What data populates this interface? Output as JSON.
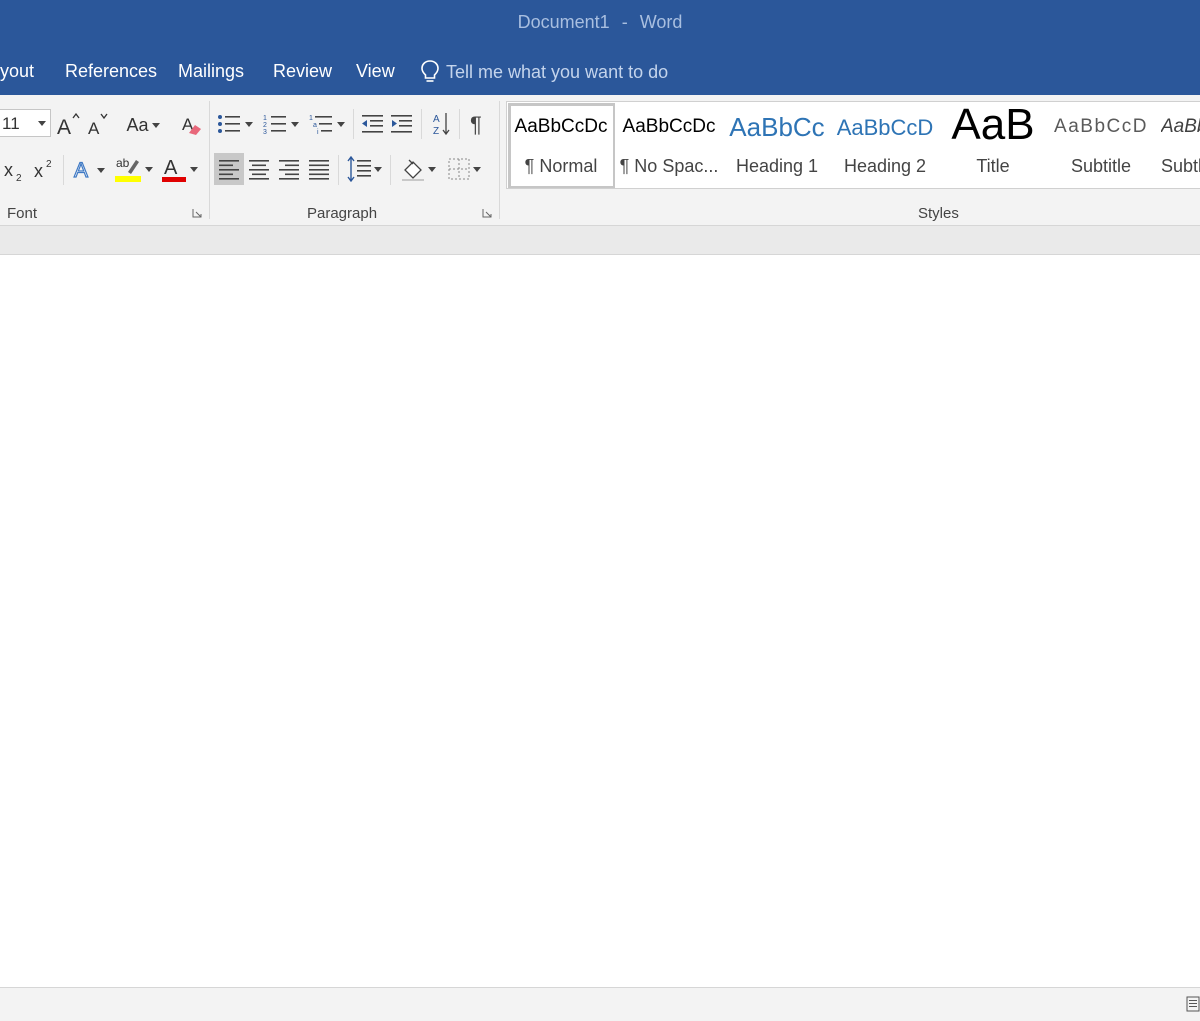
{
  "window": {
    "document_name": "Document1",
    "separator": "-",
    "app_name": "Word"
  },
  "tabs": [
    {
      "label": "yout"
    },
    {
      "label": "References"
    },
    {
      "label": "Mailings"
    },
    {
      "label": "Review"
    },
    {
      "label": "View"
    }
  ],
  "tell_me": {
    "text": "Tell me what you want to do",
    "icon": "lightbulb-icon"
  },
  "font_group": {
    "label": "Font",
    "font_size": "11",
    "change_case_label": "Aa",
    "highlight_color": "#ffff00",
    "font_color": "#e00000"
  },
  "paragraph_group": {
    "label": "Paragraph"
  },
  "styles_group": {
    "label": "Styles",
    "items": [
      {
        "preview": "AaBbCcDc",
        "name": "¶ Normal",
        "selected": true
      },
      {
        "preview": "AaBbCcDc",
        "name": "¶ No Spac..."
      },
      {
        "preview": "AaBbCc",
        "name": "Heading 1"
      },
      {
        "preview": "AaBbCcD",
        "name": "Heading 2"
      },
      {
        "preview": "AaB",
        "name": "Title"
      },
      {
        "preview": "AaBbCcD",
        "name": "Subtitle"
      },
      {
        "preview": "AaBb",
        "name": "Subtl"
      }
    ]
  },
  "colors": {
    "title_bar": "#2b579a",
    "ribbon": "#f3f3f3",
    "accent_blue": "#2b579a"
  }
}
